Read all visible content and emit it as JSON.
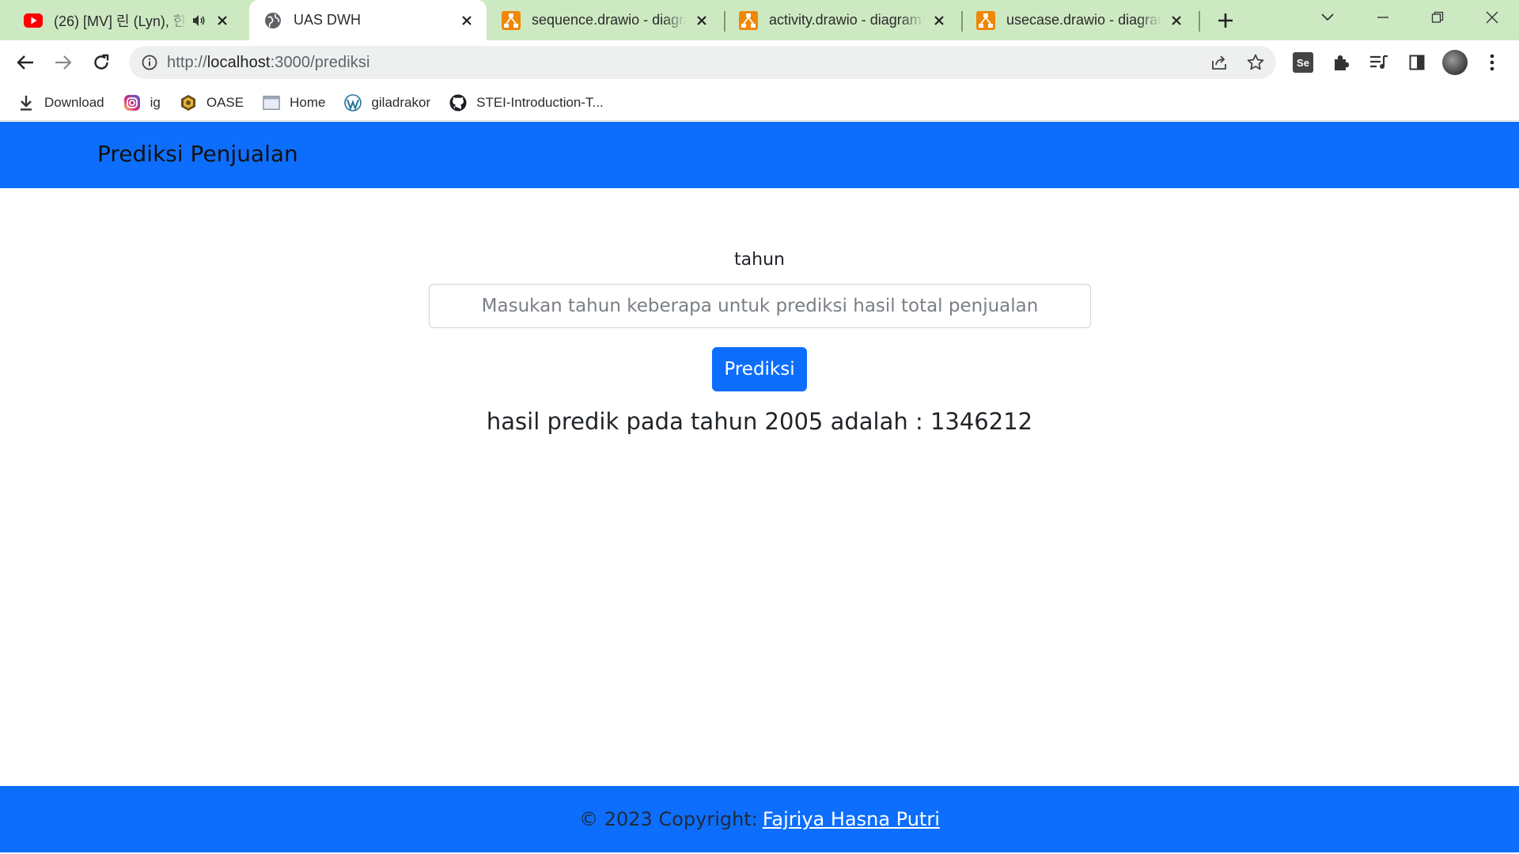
{
  "browser": {
    "tabs": [
      {
        "title": "(26) [MV] 린 (Lyn), 한",
        "icon": "youtube-icon",
        "audio": true,
        "active": false
      },
      {
        "title": "UAS DWH",
        "icon": "globe-icon",
        "audio": false,
        "active": true
      },
      {
        "title": "sequence.drawio - diagrams.net",
        "icon": "drawio-icon",
        "audio": false,
        "active": false
      },
      {
        "title": "activity.drawio - diagrams.net",
        "icon": "drawio-icon",
        "audio": false,
        "active": false
      },
      {
        "title": "usecase.drawio - diagrams.net",
        "icon": "drawio-icon",
        "audio": false,
        "active": false
      }
    ],
    "address": {
      "prefix": "http://",
      "host": "localhost",
      "rest": ":3000/prediksi"
    },
    "bookmarks": [
      {
        "label": "Download",
        "icon": "download-icon"
      },
      {
        "label": "ig",
        "icon": "instagram-icon"
      },
      {
        "label": "OASE",
        "icon": "oase-icon"
      },
      {
        "label": "Home",
        "icon": "page-icon"
      },
      {
        "label": "giladrakor",
        "icon": "wordpress-icon"
      },
      {
        "label": "STEI-Introduction-T...",
        "icon": "github-icon"
      }
    ],
    "profile_initials": "Se"
  },
  "page": {
    "brand": "Prediksi Penjualan",
    "form": {
      "label": "tahun",
      "input_value": "",
      "input_placeholder": "Masukan tahun keberapa untuk prediksi hasil total penjualan",
      "button_label": "Prediksi"
    },
    "result": "hasil predik pada tahun 2005 adalah : 1346212",
    "footer": {
      "text": "© 2023 Copyright:",
      "link": "Fajriya Hasna Putri"
    }
  },
  "colors": {
    "primary": "#0d6efd",
    "tabstrip": "#cde9c2",
    "youtube_red": "#ff0000",
    "drawio_orange": "#f08705"
  }
}
